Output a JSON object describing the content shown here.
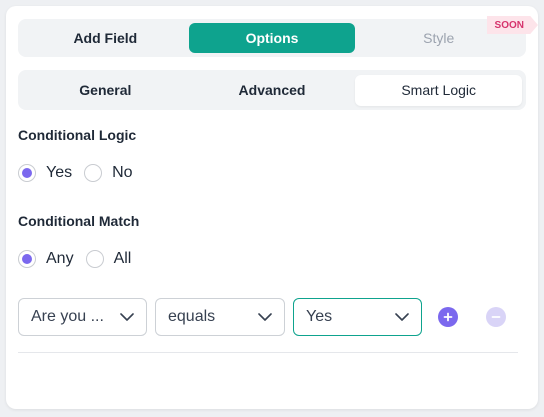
{
  "top_tabs": {
    "add_field": "Add Field",
    "options": "Options",
    "style": "Style",
    "soon_badge": "SOON"
  },
  "sub_tabs": {
    "general": "General",
    "advanced": "Advanced",
    "smart_logic": "Smart Logic"
  },
  "conditional_logic": {
    "title": "Conditional Logic",
    "options": [
      "Yes",
      "No"
    ],
    "selected": "Yes"
  },
  "conditional_match": {
    "title": "Conditional Match",
    "options": [
      "Any",
      "All"
    ],
    "selected": "Any"
  },
  "condition": {
    "field_value": "Are you ...",
    "operator_value": "equals",
    "value_value": "Yes"
  },
  "colors": {
    "accent": "#0ea38e",
    "radio": "#7b68ee",
    "add_button": "#7b68ee",
    "remove_button": "#d9d4f7",
    "soon_badge_bg": "#fde4ea",
    "soon_badge_text": "#d6336c"
  }
}
